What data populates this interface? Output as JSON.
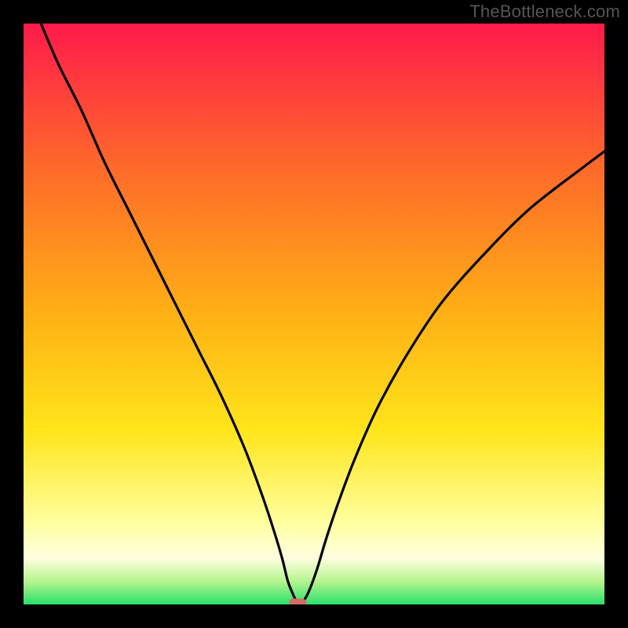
{
  "watermark": "TheBottleneck.com",
  "chart_data": {
    "type": "line",
    "title": "",
    "xlabel": "",
    "ylabel": "",
    "xlim": [
      0,
      100
    ],
    "ylim": [
      0,
      100
    ],
    "background_gradient": {
      "direction": "vertical",
      "stops": [
        {
          "pos": 0.0,
          "color": "#ff1a4b"
        },
        {
          "pos": 0.25,
          "color": "#ff6a2a"
        },
        {
          "pos": 0.5,
          "color": "#ffb015"
        },
        {
          "pos": 0.7,
          "color": "#ffe51a"
        },
        {
          "pos": 0.86,
          "color": "#ffffa0"
        },
        {
          "pos": 0.92,
          "color": "#ffffe0"
        },
        {
          "pos": 0.96,
          "color": "#b7f48f"
        },
        {
          "pos": 1.0,
          "color": "#29e06a"
        }
      ]
    },
    "series": [
      {
        "name": "bottleneck-curve",
        "color": "#000000",
        "x": [
          3,
          6,
          10,
          14,
          18,
          22,
          26,
          30,
          34,
          38,
          41,
          43,
          44.5,
          45.5,
          46.5,
          47.2,
          48,
          49,
          50.5,
          52,
          54,
          57,
          61,
          66,
          72,
          79,
          87,
          96,
          100
        ],
        "y": [
          100,
          93,
          85,
          76,
          68,
          60,
          52,
          44,
          36,
          27,
          19,
          13,
          8,
          4,
          1.5,
          0.2,
          0.4,
          2,
          6,
          11,
          17,
          25,
          34,
          43,
          52,
          60,
          68,
          75,
          78
        ]
      }
    ],
    "marker": {
      "x": 47.2,
      "y": 0.2,
      "color": "#d46a6a",
      "shape": "rounded-rect"
    }
  }
}
